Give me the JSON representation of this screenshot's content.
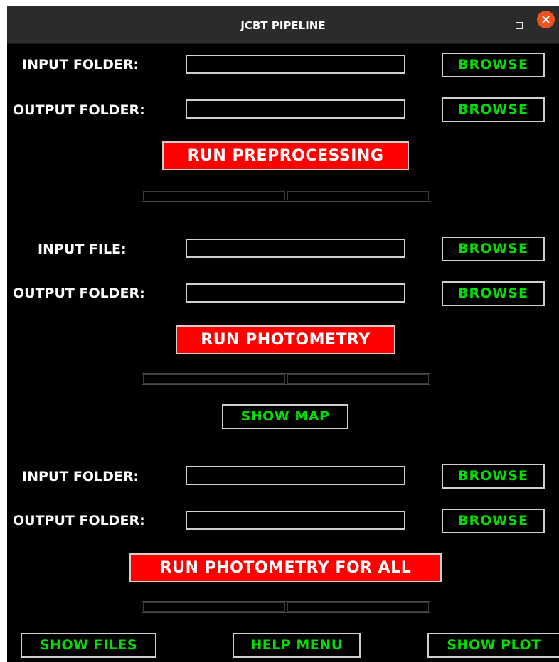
{
  "window": {
    "title": "JCBT PIPELINE"
  },
  "preprocessing": {
    "input_label": "INPUT FOLDER:",
    "input_value": "",
    "output_label": "OUTPUT FOLDER:",
    "output_value": "",
    "browse_input": "BROWSE",
    "browse_output": "BROWSE",
    "run_label": "RUN PREPROCESSING",
    "progress": 0
  },
  "photometry": {
    "input_label": "INPUT FILE:",
    "input_value": "",
    "output_label": "OUTPUT FOLDER:",
    "output_value": "",
    "browse_input": "BROWSE",
    "browse_output": "BROWSE",
    "run_label": "RUN PHOTOMETRY",
    "progress": 0,
    "show_map": "SHOW MAP"
  },
  "photometry_all": {
    "input_label": "INPUT FOLDER:",
    "input_value": "",
    "output_label": "OUTPUT FOLDER:",
    "output_value": "",
    "browse_input": "BROWSE",
    "browse_output": "BROWSE",
    "run_label": "RUN PHOTOMETRY FOR ALL",
    "progress": 0
  },
  "footer": {
    "show_files": "SHOW FILES",
    "help_menu": "HELP MENU",
    "show_plot": "SHOW PLOT"
  },
  "colors": {
    "background": "#000000",
    "run_button": "#ff0000",
    "browse_text": "#00e000",
    "close_button": "#e95420"
  }
}
